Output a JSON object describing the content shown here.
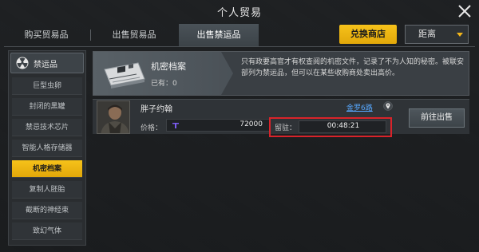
{
  "window": {
    "title": "个人贸易"
  },
  "tabs": [
    {
      "label": "购买贸易品"
    },
    {
      "label": "出售贸易品"
    },
    {
      "label": "出售禁运品"
    }
  ],
  "toolbar": {
    "exchange_label": "兑换商店",
    "distance_label": "距离"
  },
  "sidebar": {
    "header_label": "禁运品",
    "items": [
      {
        "label": "巨型虫卵"
      },
      {
        "label": "封闭的黑罐"
      },
      {
        "label": "禁忌技术芯片"
      },
      {
        "label": "智能人格存储器"
      },
      {
        "label": "机密档案"
      },
      {
        "label": "复制人胚胎"
      },
      {
        "label": "截断的神经束"
      },
      {
        "label": "致幻气体"
      }
    ],
    "selected": "机密档案"
  },
  "banner": {
    "item_name": "机密档案",
    "owned_text": "已有：0",
    "description": "只有政要高官才有权查阅的机密文件，记录了不为人知的秘密。被联安部列为禁运品，但可以在某些收购商处卖出高价。"
  },
  "listing": {
    "seller_name": "胖子约翰",
    "location": "金罗6路",
    "price_label": "价格：",
    "price_value": "72000",
    "stay_label": "留驻：",
    "time_remaining": "00:48:21",
    "sell_button": "前往出售"
  },
  "colors": {
    "accent": "#f3b61b",
    "link": "#57a8ff",
    "highlight_frame": "#d9232a",
    "currency": "#7b5cf0"
  },
  "icons": {
    "close": "close-icon",
    "radiation": "radiation-icon",
    "card": "circuit-card-icon",
    "pin": "location-pin-icon",
    "currency": "currency-icon"
  }
}
